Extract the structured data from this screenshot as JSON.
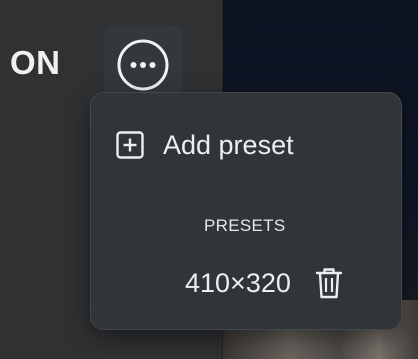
{
  "toolbar": {
    "label": "ON",
    "more_icon": "more-horizontal-circle-icon"
  },
  "menu": {
    "add_preset": {
      "icon": "plus-square-icon",
      "label": "Add preset"
    },
    "section_header": "PRESETS",
    "presets": [
      {
        "label": "410×320",
        "delete_icon": "trash-icon"
      }
    ]
  },
  "colors": {
    "panel": "#2f3133",
    "menu_bg": "#323538",
    "menu_border": "#44484c",
    "text": "#eceef0"
  }
}
